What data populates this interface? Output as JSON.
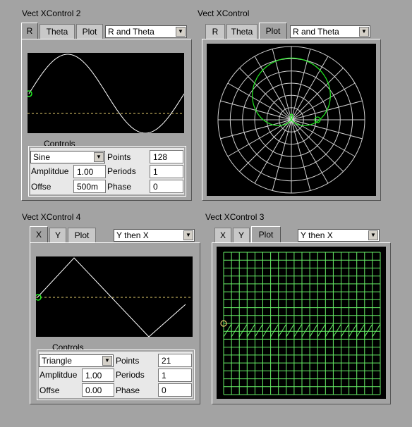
{
  "modules": {
    "vx2": {
      "title": "Vect XControl 2",
      "tabs": [
        "R",
        "Theta",
        "Plot"
      ],
      "select": "R and Theta",
      "controls": {
        "heading": "Controls",
        "waveform": "Sine",
        "amplitude_label": "Amplitdue",
        "amplitude": "1.00",
        "offset_label": "Offse",
        "offset": "500m",
        "points_label": "Points",
        "points": "128",
        "periods_label": "Periods",
        "periods": "1",
        "phase_label": "Phase",
        "phase": "0"
      }
    },
    "vx": {
      "title": "Vect XControl",
      "tabs": [
        "R",
        "Theta",
        "Plot"
      ],
      "select": "R and Theta"
    },
    "vx4": {
      "title": "Vect XControl 4",
      "tabs": [
        "X",
        "Y",
        "Plot"
      ],
      "select": "Y then X",
      "controls": {
        "heading": "Controls",
        "waveform": "Triangle",
        "amplitude_label": "Amplitdue",
        "amplitude": "1.00",
        "offset_label": "Offse",
        "offset": "0.00",
        "points_label": "Points",
        "points": "21",
        "periods_label": "Periods",
        "periods": "1",
        "phase_label": "Phase",
        "phase": "0"
      }
    },
    "vx3": {
      "title": "Vect XControl 3",
      "tabs": [
        "X",
        "Y",
        "Plot"
      ],
      "select": "Y then X"
    }
  },
  "colors": {
    "background": "#a3a3a3",
    "plot_bg": "#000000",
    "trace_white": "#ffffff",
    "trace_green": "#22ee22",
    "grid_green": "#66ee66",
    "dashed_yellow": "#e8d070",
    "polar_grid": "#d0d0d0"
  }
}
